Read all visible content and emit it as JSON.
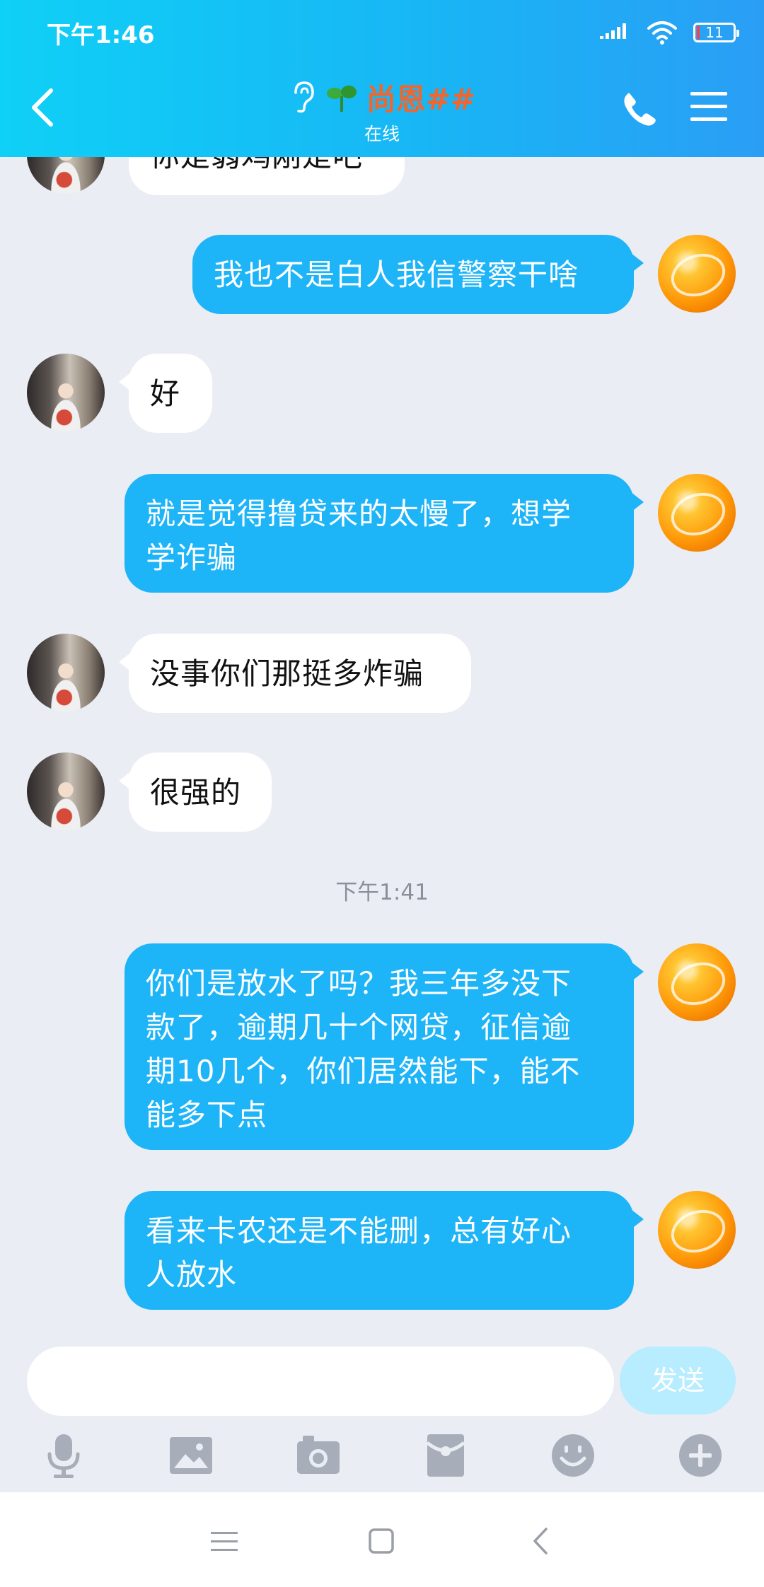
{
  "status_bar": {
    "time": "下午1:46",
    "battery": "11"
  },
  "header": {
    "contact_name": "尚恩##",
    "presence": "在线"
  },
  "messages": [
    {
      "side": "in",
      "lines": [
        "你是弱鸡刚是吧"
      ]
    },
    {
      "side": "out",
      "lines": [
        "我也不是白人我信警察干啥"
      ]
    },
    {
      "side": "in",
      "lines": [
        "好"
      ]
    },
    {
      "side": "out",
      "lines": [
        "就是觉得撸贷来的太慢了，想学",
        "学诈骗"
      ]
    },
    {
      "side": "in",
      "lines": [
        "没事你们那挺多炸骗"
      ]
    },
    {
      "side": "in",
      "lines": [
        "很强的"
      ]
    },
    {
      "side": "out",
      "lines": [
        "你们是放水了吗？我三年多没下",
        "款了，逾期几十个网贷，征信逾",
        "期10几个，你们居然能下，能不",
        "能多下点"
      ]
    },
    {
      "side": "out",
      "lines": [
        "看来卡农还是不能删，总有好心",
        "人放水"
      ]
    }
  ],
  "timestamp": "下午1:41",
  "composer": {
    "value": "",
    "placeholder": "",
    "send_label": "发送"
  },
  "toolbar": [
    "microphone-icon",
    "image-icon",
    "camera-icon",
    "red-packet-icon",
    "emoji-icon",
    "plus-icon"
  ],
  "colors": {
    "header_start": "#0fd0f6",
    "header_end": "#2a9ef5",
    "outgoing_bubble": "#1db4f8",
    "incoming_bubble": "#ffffff",
    "contact_name": "#f2662e",
    "send_button": "#b8ecff",
    "background": "#eaedf4"
  }
}
